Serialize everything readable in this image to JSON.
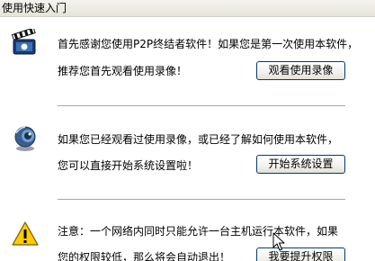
{
  "window": {
    "title": "使用快速入门"
  },
  "intro": {
    "icon": "video-clapperboard-icon",
    "line1": "首先感谢您使用P2P终结者软件！如果您是第一次使用本软件，",
    "line2": "推荐您首先观看使用录像！",
    "button_label": "观看使用录像"
  },
  "setup": {
    "icon": "globe-webcam-icon",
    "line1": "如果您已经观看过使用录像，或已经了解如何使用本软件，",
    "line2": "您可以直接开始系统设置啦！",
    "button_label": "开始系统设置"
  },
  "warning": {
    "icon": "warning-triangle-icon",
    "line1": "注意：一个网络内同时只能允许一台主机运行本软件，如果",
    "line2": "您的权限较低，那么将会自动退出！",
    "button_label": "我要提升权限"
  },
  "colors": {
    "button_border": "#003c74",
    "divider": "#a7a6aa",
    "warning_yellow": "#ffcc00"
  }
}
